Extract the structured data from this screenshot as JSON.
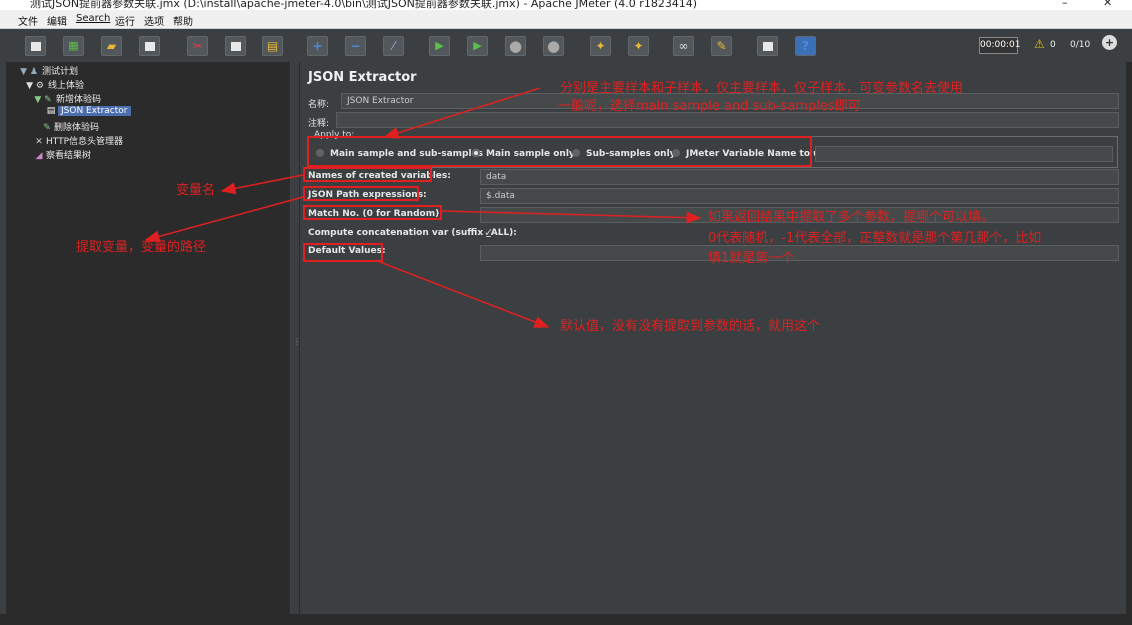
{
  "window": {
    "title": "测试JSON提前器参数关联.jmx (D:\\install\\apache-jmeter-4.0\\bin\\测试JSON提前器参数关联.jmx) - Apache JMeter (4.0 r1823414)",
    "min_glyph": "–",
    "close_glyph": "✕"
  },
  "menu": [
    "文件",
    "编辑",
    "Search",
    "运行",
    "选项",
    "帮助"
  ],
  "toolbar": {
    "icons": [
      "new-icon",
      "templates-icon",
      "open-icon",
      "save-icon",
      "cut-icon",
      "copy-icon",
      "paste-icon",
      "expand-icon",
      "collapse-icon",
      "toggle-icon",
      "start-icon",
      "start-no-pause-icon",
      "stop-icon",
      "shutdown-icon",
      "clear-icon",
      "clear-all-icon",
      "search-icon",
      "reset-search-icon",
      "function-helper-icon",
      "help-icon"
    ],
    "timer": "00:00:01",
    "warning_count": "0",
    "threads": "0/10"
  },
  "tree": {
    "nodes": [
      {
        "label": "测试计划",
        "icon": "test-plan-icon",
        "glyph": "▼ ♟",
        "depth": 0
      },
      {
        "label": "线上体验",
        "icon": "thread-group-icon",
        "glyph": "▼ ⚙",
        "depth": 1
      },
      {
        "label": "新增体验码",
        "icon": "http-sampler-icon",
        "glyph": "▼ ✎",
        "depth": 2
      },
      {
        "label": "JSON Extractor",
        "icon": "json-extractor-icon",
        "glyph": "▤",
        "depth": 3,
        "selected": true
      },
      {
        "label": "删除体验码",
        "icon": "http-sampler-icon",
        "glyph": "✎",
        "depth": 2
      },
      {
        "label": "HTTP信息头管理器",
        "icon": "header-manager-icon",
        "glyph": "✕",
        "depth": 2
      },
      {
        "label": "察看结果树",
        "icon": "results-tree-icon",
        "glyph": "◢",
        "depth": 2
      }
    ]
  },
  "panel": {
    "title": "JSON Extractor",
    "name_label": "名称:",
    "name_value": "JSON Extractor",
    "comment_label": "注释:",
    "comment_value": "",
    "apply_to": "Apply to:",
    "radios": [
      {
        "label": "Main sample and sub-samples",
        "selected": false
      },
      {
        "label": "Main sample only",
        "selected": true
      },
      {
        "label": "Sub-samples only",
        "selected": false
      },
      {
        "label": "JMeter Variable Name to use",
        "selected": false
      }
    ],
    "variable_name_value": "",
    "names_label": "Names of created variables:",
    "names_value": "data",
    "jsonpath_label": "JSON Path expressions:",
    "jsonpath_value": "$.data",
    "matchno_label": "Match No. (0 for Random):",
    "matchno_value": "",
    "concat_label": "Compute concatenation var (suffix _ALL):",
    "concat_checked": true,
    "default_label": "Default Values:",
    "default_value": ""
  },
  "annotations": {
    "apply_note_1": "分别是主要样本和子样本，仅主要样本，仅子样本，可变参数名去使用",
    "apply_note_2": "一般呢，选择main sample and sub-samples即可",
    "varname_note": "变量名",
    "path_note": "提取变量，变量的路径",
    "match_note_1": "如果返回结果中提取了多个参数，提哪个可以填。",
    "match_note_2": "0代表随机，-1代表全部，正整数就是那个第几那个，比如",
    "match_note_3": "填1就是第一个",
    "default_note": "默认值，没有没有提取到参数的话，就用这个",
    "annotation_color": "#e02020"
  }
}
